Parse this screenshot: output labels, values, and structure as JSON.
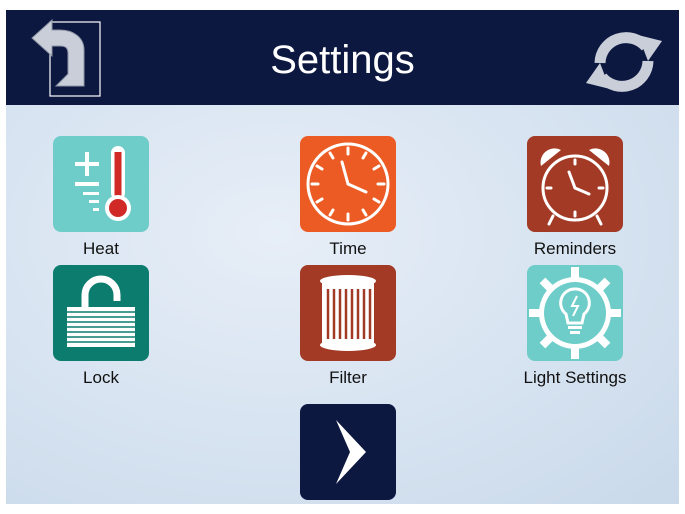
{
  "header": {
    "title": "Settings",
    "background": "#0d1840",
    "back_icon": "back-arrow-icon",
    "refresh_icon": "refresh-icon"
  },
  "grid": {
    "items": [
      {
        "label": "Heat",
        "icon": "thermometer-icon",
        "color": "#6ecdc9"
      },
      {
        "label": "Time",
        "icon": "clock-icon",
        "color": "#ec5b24"
      },
      {
        "label": "Reminders",
        "icon": "alarm-clock-icon",
        "color": "#a33a25"
      },
      {
        "label": "Lock",
        "icon": "padlock-icon",
        "color": "#0c7c6e"
      },
      {
        "label": "Filter",
        "icon": "filter-icon",
        "color": "#a33a25"
      },
      {
        "label": "Light Settings",
        "icon": "light-bulb-gear-icon",
        "color": "#6ecdc9"
      }
    ]
  },
  "next": {
    "icon": "chevron-right-icon",
    "color": "#0d1840"
  }
}
